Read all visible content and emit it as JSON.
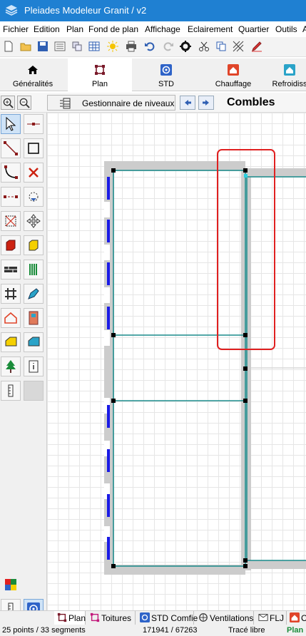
{
  "window": {
    "title": "Pleiades Modeleur  Granit / v2"
  },
  "menu": [
    "Fichier",
    "Edition",
    "Plan",
    "Fond de plan",
    "Affichage",
    "Eclairement",
    "Quartier",
    "Outils",
    "A"
  ],
  "toolbar": {
    "icons": [
      "new-file-icon",
      "open-folder-icon",
      "save-icon",
      "list-icon",
      "layers-icon",
      "table-icon",
      "sun-icon",
      "print-icon",
      "undo-icon",
      "redo-icon",
      "gear-icon",
      "cut-icon",
      "copy-icon",
      "hatch-icon",
      "edit-icon"
    ]
  },
  "tabs": [
    {
      "label": "Généralités",
      "icon": "house-icon",
      "color": "#000000"
    },
    {
      "label": "Plan",
      "icon": "plan-icon",
      "color": "#7a1a2a"
    },
    {
      "label": "STD",
      "icon": "std-icon",
      "color": "#2e63c8"
    },
    {
      "label": "Chauffage",
      "icon": "heating-icon",
      "color": "#e0452a"
    },
    {
      "label": "Refroidiss",
      "icon": "cooling-icon",
      "color": "#2aa3c8"
    }
  ],
  "levelbar": {
    "gestion_label": "Gestionnaire de niveaux",
    "level_name": "Combles"
  },
  "bottom_tabs": [
    {
      "label": "Plan",
      "icon": "plan-icon"
    },
    {
      "label": "Toitures",
      "icon": "roof-icon"
    },
    {
      "label": "STD Comfie",
      "icon": "std-icon"
    },
    {
      "label": "Ventilations",
      "icon": "ventilation-icon"
    },
    {
      "label": "FLJ",
      "icon": "flj-icon"
    },
    {
      "label": "C",
      "icon": "heating-icon"
    }
  ],
  "status": {
    "counts": "25 points / 33 segments",
    "coords": "171941 / 67263",
    "mode": "Tracé libre",
    "view": "Plan"
  },
  "colors": {
    "titlebar": "#1f80d2",
    "wall": "#cccccc",
    "wall_line": "#1a8c8c",
    "window": "#1a1ae6",
    "highlight": "#e02020"
  }
}
